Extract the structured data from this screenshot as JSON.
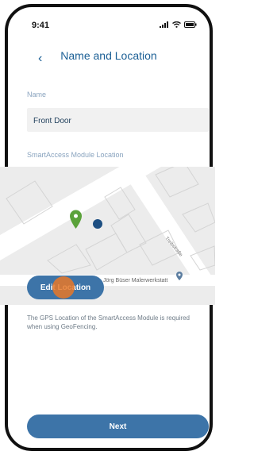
{
  "status_bar": {
    "time": "9:41"
  },
  "header": {
    "title": "Name and Location"
  },
  "form": {
    "name_label": "Name",
    "name_value": "Front Door",
    "module_location_label": "SmartAccess Module Location"
  },
  "map": {
    "street_label": "Treibstraße",
    "poi_label": "Jörg Büser Malerwerkstatt",
    "edit_button_label": "Edit Location"
  },
  "help_text": "The GPS Location of the SmartAccess Module is required when using GeoFencing.",
  "footer": {
    "next_label": "Next"
  },
  "colors": {
    "primary": "#3d74a8",
    "title": "#1b5f95",
    "pin_green": "#5aa23a",
    "user_dot": "#1d4f82",
    "touch_indicator": "#e87828"
  },
  "icons": [
    "back-chevron-icon",
    "signal-icon",
    "wifi-icon",
    "battery-icon",
    "location-pin-icon",
    "user-location-dot-icon",
    "poi-icon"
  ]
}
